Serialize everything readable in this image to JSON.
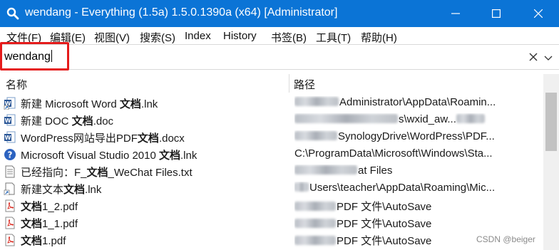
{
  "window": {
    "title": "wendang - Everything (1.5a) 1.5.0.1390a (x64) [Administrator]"
  },
  "menu": [
    "文件(F)",
    "编辑(E)",
    "视图(V)",
    "搜索(S)",
    "Index",
    "History",
    "书签(B)",
    "工具(T)",
    "帮助(H)"
  ],
  "search": {
    "value": "wendang"
  },
  "columns": {
    "name": "名称",
    "path": "路径"
  },
  "files": [
    {
      "icon": "word-shortcut-icon",
      "prefix": "新建 Microsoft Word ",
      "bold": "文档",
      "suffix": ".lnk",
      "path_visible": "Administrator\\AppData\\Roamin..."
    },
    {
      "icon": "word-doc-icon",
      "prefix": "新建 DOC ",
      "bold": "文档",
      "suffix": ".doc",
      "path_visible": "s\\wxid_aw..."
    },
    {
      "icon": "word-doc-icon",
      "prefix": "WordPress网站导出PDF",
      "bold": "文档",
      "suffix": ".docx",
      "path_visible": "SynologyDrive\\WordPress\\PDF..."
    },
    {
      "icon": "help-file-icon",
      "prefix": "Microsoft Visual Studio 2010 ",
      "bold": "文档",
      "suffix": ".lnk",
      "path_visible": "C:\\ProgramData\\Microsoft\\Windows\\Sta..."
    },
    {
      "icon": "text-file-icon",
      "prefix": "已经指向：F_",
      "bold": "文档",
      "suffix": "_WeChat Files.txt",
      "path_visible": "at Files"
    },
    {
      "icon": "shortcut-file-icon",
      "prefix": "新建文本",
      "bold": "文档",
      "suffix": ".lnk",
      "path_visible": "Users\\teacher\\AppData\\Roaming\\Mic..."
    },
    {
      "icon": "pdf-file-icon",
      "prefix": "",
      "bold": "文档",
      "suffix": "1_2.pdf",
      "path_visible": "PDF 文件\\AutoSave"
    },
    {
      "icon": "pdf-file-icon",
      "prefix": "",
      "bold": "文档",
      "suffix": "1_1.pdf",
      "path_visible": "PDF 文件\\AutoSave"
    },
    {
      "icon": "pdf-file-icon",
      "prefix": "",
      "bold": "文档",
      "suffix": "1.pdf",
      "path_visible": "PDF 文件\\AutoSave"
    }
  ],
  "watermark": "CSDN @beiger"
}
